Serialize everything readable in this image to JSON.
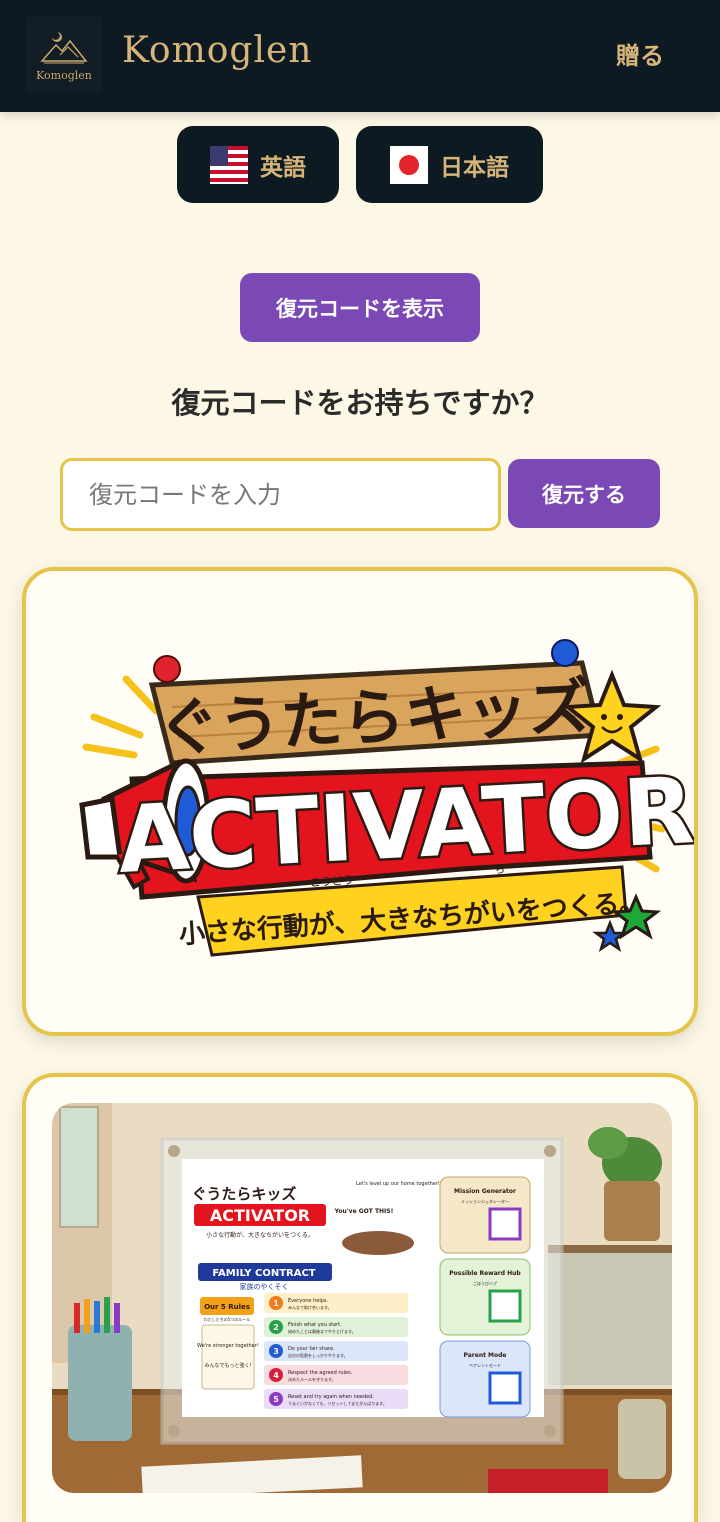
{
  "header": {
    "logo_text": "Komoglen",
    "brand": "Komoglen",
    "gift_label": "贈る"
  },
  "languages": [
    {
      "label": "英語",
      "flag": "us-flag-icon"
    },
    {
      "label": "日本語",
      "flag": "jp-flag-icon"
    }
  ],
  "restore": {
    "show_code_label": "復元コードを表示",
    "question": "復元コードをお持ちですか？",
    "input_placeholder": "復元コードを入力",
    "input_value": "",
    "submit_label": "復元する"
  },
  "banner": {
    "title": "ぐうたらキッズ",
    "subtitle": "ACTIVATOR",
    "tagline": "小さな行動が、大きなちがいをつくる。",
    "ruby_kodou": "こうどう",
    "ruby_chi": "ち"
  },
  "poster": {
    "title": "ぐうたらキッズ",
    "subtitle": "ACTIVATOR",
    "tagline": "小さな行動が、大きなちがいをつくる。",
    "bubble_1": "You've GOT THIS!",
    "bubble_2": "Let's level up our home together!",
    "contract_title": "FAMILY CONTRACT",
    "contract_subtitle": "家族のやくそく",
    "rules_heading": "Our 5 Rules",
    "rules_subheading": "わたしたちの5つのルール",
    "stronger_en": "We're stronger together!",
    "stronger_ja": "みんなでもっと強く!",
    "rules": [
      {
        "num": "1",
        "en": "Everyone helps.",
        "ja": "みんなで助け合います。"
      },
      {
        "num": "2",
        "en": "Finish what you start.",
        "ja": "始めたことは最後までやりとげます。"
      },
      {
        "num": "3",
        "en": "Do your fair share.",
        "ja": "自分の役割をしっかりやります。"
      },
      {
        "num": "4",
        "en": "Respect the agreed rules.",
        "ja": "決めたルールを守ります。"
      },
      {
        "num": "5",
        "en": "Reset and try again when needed.",
        "ja": "うまくいかなくても、リセットしてまたがんばります。"
      }
    ],
    "side": [
      {
        "en": "Mission Generator",
        "ja": "ミッションジェネレーター"
      },
      {
        "en": "Possible Reward Hub",
        "ja": "ごほうびハブ"
      },
      {
        "en": "Parent Mode",
        "ja": "ペアレントモード"
      }
    ]
  },
  "colors": {
    "header_bg": "#0e1a22",
    "gold": "#d7b57a",
    "page_bg": "#fdf7e6",
    "purple": "#7a49b5",
    "card_border": "#e6c34a"
  }
}
